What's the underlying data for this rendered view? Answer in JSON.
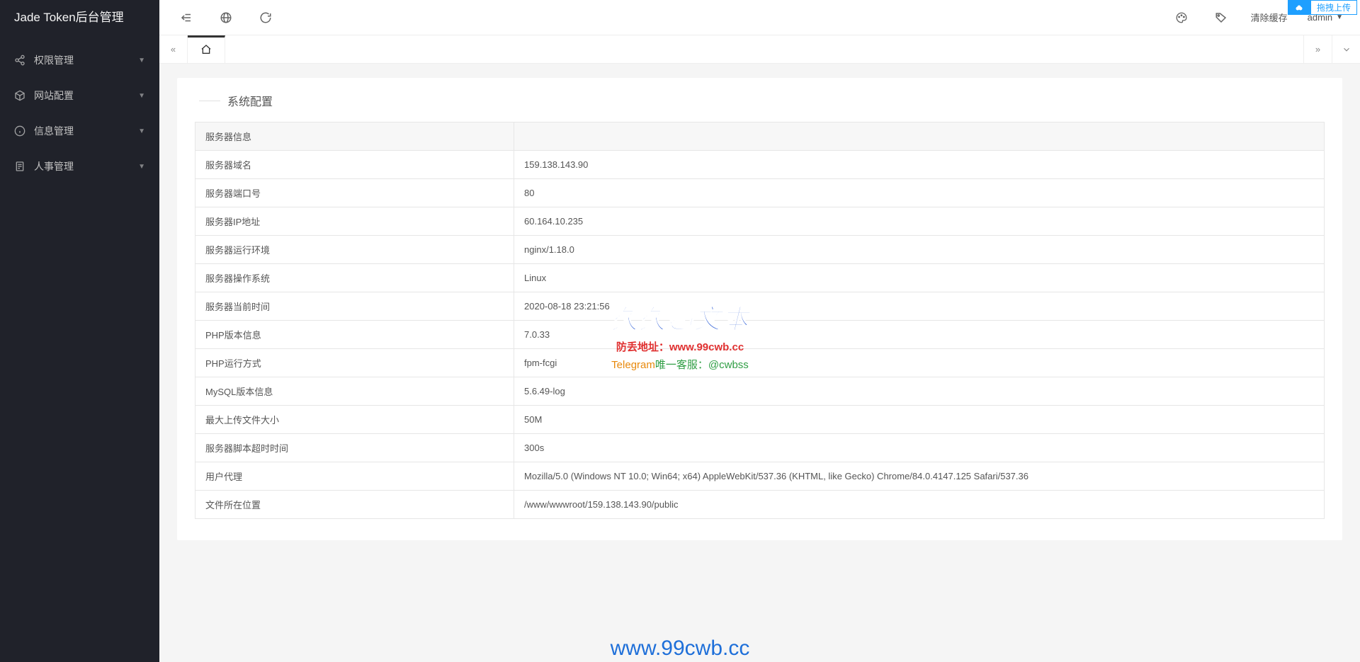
{
  "app_title": "Jade Token后台管理",
  "sidebar": {
    "items": [
      {
        "label": "权限管理",
        "icon": "share"
      },
      {
        "label": "网站配置",
        "icon": "cube"
      },
      {
        "label": "信息管理",
        "icon": "info"
      },
      {
        "label": "人事管理",
        "icon": "doc"
      }
    ]
  },
  "header": {
    "clear_cache": "清除缓存",
    "user": "admin"
  },
  "card": {
    "title": "系统配置"
  },
  "table": {
    "header": "服务器信息",
    "rows": [
      {
        "k": "服务器域名",
        "v": "159.138.143.90"
      },
      {
        "k": "服务器端口号",
        "v": "80"
      },
      {
        "k": "服务器IP地址",
        "v": "60.164.10.235"
      },
      {
        "k": "服务器运行环境",
        "v": "nginx/1.18.0"
      },
      {
        "k": "服务器操作系统",
        "v": "Linux"
      },
      {
        "k": "服务器当前时间",
        "v": "2020-08-18 23:21:56"
      },
      {
        "k": "PHP版本信息",
        "v": "7.0.33"
      },
      {
        "k": "PHP运行方式",
        "v": "fpm-fcgi"
      },
      {
        "k": "MySQL版本信息",
        "v": "5.6.49-log"
      },
      {
        "k": "最大上传文件大小",
        "v": "50M"
      },
      {
        "k": "服务器脚本超时时间",
        "v": "300s"
      },
      {
        "k": "用户代理",
        "v": "Mozilla/5.0 (Windows NT 10.0; Win64; x64) AppleWebKit/537.36 (KHTML, like Gecko) Chrome/84.0.4147.125 Safari/537.36"
      },
      {
        "k": "文件所在位置",
        "v": "/www/wwwroot/159.138.143.90/public"
      }
    ]
  },
  "top_badge": {
    "upload": "拖拽上传"
  },
  "watermark": {
    "title": "久久超文本",
    "line1_label": "防丢地址：",
    "line1_url": "www.99cwb.cc",
    "line2_a": "Telegram",
    "line2_b": "唯一客服：",
    "line2_c": "@cwbss",
    "bottom": "www.99cwb.cc"
  }
}
